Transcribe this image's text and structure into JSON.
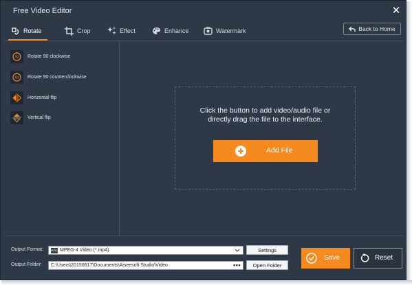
{
  "window": {
    "title": "Free Video Editor"
  },
  "tabs": [
    {
      "label": "Rotate",
      "icon": "rotate-icon",
      "active": true
    },
    {
      "label": "Crop",
      "icon": "crop-icon"
    },
    {
      "label": "Effect",
      "icon": "effect-icon"
    },
    {
      "label": "Enhance",
      "icon": "enhance-icon"
    },
    {
      "label": "Watermark",
      "icon": "watermark-icon"
    }
  ],
  "back_button": {
    "label": "Back to Home",
    "icon": "back-arrow-icon"
  },
  "sidebar": {
    "items": [
      {
        "label": "Rotate 90 clockwise",
        "icon": "rotate-90-clockwise-icon"
      },
      {
        "label": "Rotate 90 counterclockwise",
        "icon": "rotate-90-counterclockwise-icon"
      },
      {
        "label": "Horizontal flip",
        "icon": "horizontal-flip-icon"
      },
      {
        "label": "Vertical flip",
        "icon": "vertical-flip-icon"
      }
    ]
  },
  "main": {
    "drop_text_line1": "Click the button to add video/audio file or",
    "drop_text_line2": "directly drag the file to the interface.",
    "add_file_label": "Add File"
  },
  "output": {
    "format_label": "Output Format:",
    "format_value": "MPEG-4 Video (*.mp4)",
    "format_icon_text": "MPEG",
    "folder_label": "Output Folder:",
    "folder_value": "C:\\Users\\20150617\\Documents\\Aiseesoft Studio\\Video",
    "folder_browse": "•••",
    "settings_label": "Settings",
    "open_folder_label": "Open Folder"
  },
  "actions": {
    "save_label": "Save",
    "reset_label": "Reset"
  },
  "colors": {
    "background": "#2e3847",
    "accent": "#f58a1f"
  }
}
